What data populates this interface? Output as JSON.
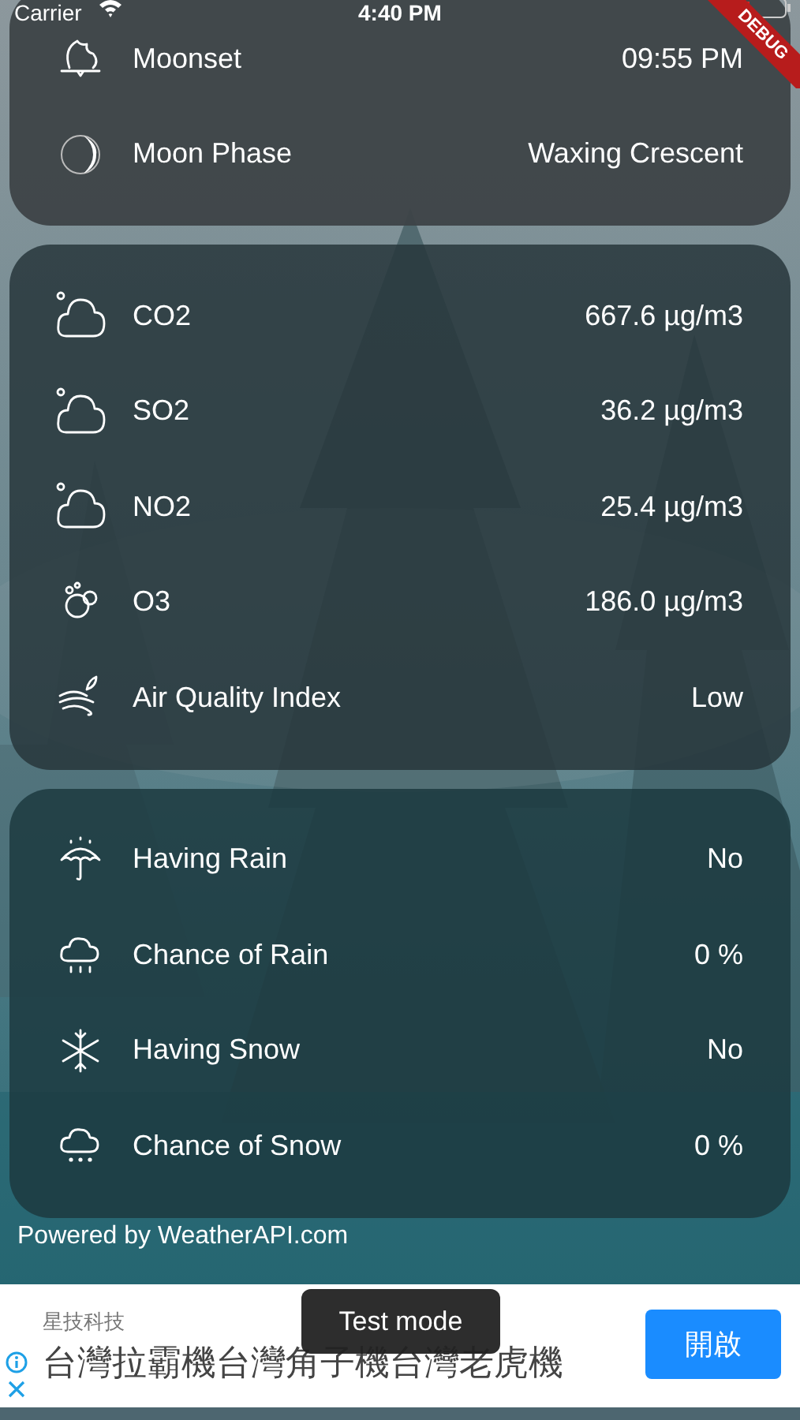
{
  "status_bar": {
    "carrier": "Carrier",
    "time": "4:40 PM"
  },
  "debug_banner": "DEBUG",
  "cards": [
    {
      "rows": [
        {
          "label": "Moonset",
          "value": "09:55 PM"
        },
        {
          "label": "Moon Phase",
          "value": "Waxing Crescent"
        }
      ]
    },
    {
      "rows": [
        {
          "label": "CO2",
          "value": "667.6 µg/m3"
        },
        {
          "label": "SO2",
          "value": "36.2 µg/m3"
        },
        {
          "label": "NO2",
          "value": "25.4 µg/m3"
        },
        {
          "label": "O3",
          "value": "186.0 µg/m3"
        },
        {
          "label": "Air Quality Index",
          "value": "Low"
        }
      ]
    },
    {
      "rows": [
        {
          "label": "Having Rain",
          "value": "No"
        },
        {
          "label": "Chance of Rain",
          "value": "0 %"
        },
        {
          "label": "Having Snow",
          "value": "No"
        },
        {
          "label": "Chance of Snow",
          "value": "0 %"
        }
      ]
    }
  ],
  "footer": "Powered by WeatherAPI.com",
  "ad": {
    "advertiser": "星技科技",
    "headline": "台灣拉霸機台灣角子機台灣老虎機",
    "button": "開啟",
    "tooltip": "Test mode"
  }
}
